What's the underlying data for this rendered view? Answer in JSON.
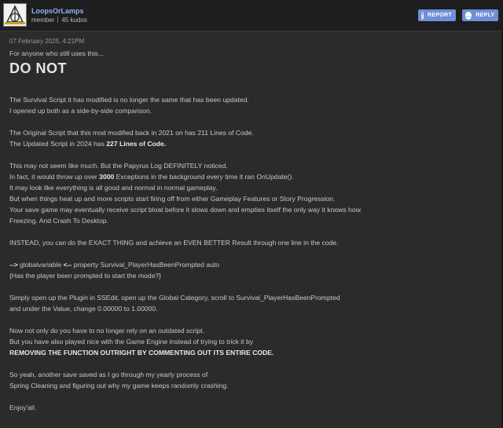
{
  "author": {
    "username": "LoopsOrLamps",
    "role": "member",
    "kudos": "45 kudos"
  },
  "actions": {
    "report_label": "REPORT",
    "reply_label": "REPLY"
  },
  "post": {
    "timestamp": "07 February 2025, 4:21PM",
    "intro": "For anyone who still uses this...",
    "heading": "DO NOT",
    "p1_l1": "The Survival Script it has modified is no longer the same that has been updated.",
    "p1_l2": "I opened up both as a side-by-side comparison.",
    "p2_l1": "The Original Script that this mod modified back in 2021 on has 211 Lines of Code.",
    "p2_l2_pre": "The Updated Script in 2024 has ",
    "p2_l2_bold": "227 Lines of Code.",
    "p3_l1": "This may not seem like much. But the Papyrus Log DEFINITELY noticed.",
    "p3_l2_pre": "In fact, it would throw up over ",
    "p3_l2_bold": "3000",
    "p3_l2_post": " Exceptions in the background every time it ran OnUpdate().",
    "p3_l3": "It may look like everything is all good and normal in normal gameplay.",
    "p3_l4": "But when things heat up and more scripts start firing off from either Gameplay Features or Story Progression.",
    "p3_l5": "Your save game may eventually receive script bloat before it slows down and empties itself the only way it knows how.",
    "p3_l6": "Freezing. And Crash To Desktop.",
    "p4": "INSTEAD, you can do the EXACT THING and achieve an EVEN BETTER Result through one line in the code.",
    "code_arrow_left": "-->",
    "code_mid": " globalvariable ",
    "code_arrow_right": "<--",
    "code_post": " property Survival_PlayerHasBeenPrompted auto",
    "code_comment": "{Has the player been prompted to start the mode?}",
    "p5_l1": "Simply open up the Plugin in SSEdit, open up the Global Category, scroll to Survival_PlayerHasBeenPrompted",
    "p5_l2": "and under the Value, change 0.00000 to 1.00000.",
    "p6_l1": "Now not only do you have to no longer rely on an outdated script.",
    "p6_l2": "But you have also played nice with the Game Engine instead of trying to trick it by",
    "p6_l3": "REMOVING THE FUNCTION OUTRIGHT BY COMMENTING OUT ITS ENTIRE CODE.",
    "p7_l1": "So yeah, another save saved as I go through my yearly process of",
    "p7_l2": "Spring Cleaning and figuring out why my game keeps randomly crashing.",
    "p8": "Enjoy'all."
  },
  "icons": {
    "report": "exclamation-icon",
    "reply": "speech-bubble-icon"
  },
  "colors": {
    "accent": "#6f8fd6",
    "username": "#8ab4f8"
  }
}
